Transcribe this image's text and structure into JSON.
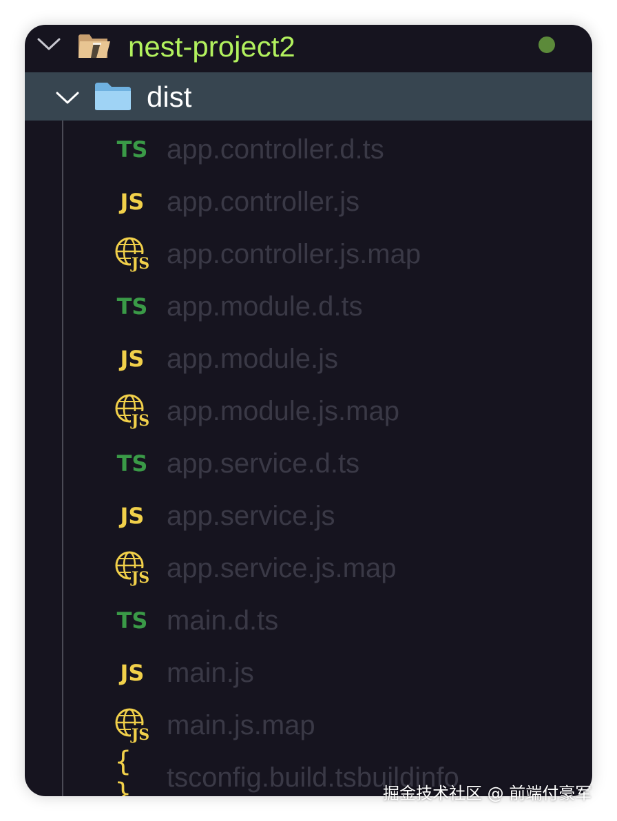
{
  "project": {
    "name": "nest-project2",
    "status_color": "#5c8a3a",
    "icon": "folder-open-icon"
  },
  "folder": {
    "name": "dist",
    "icon": "folder-icon"
  },
  "files": [
    {
      "name": "app.controller.d.ts",
      "type": "ts",
      "icon_label": "TS",
      "icon": "typescript-icon"
    },
    {
      "name": "app.controller.js",
      "type": "js",
      "icon_label": "JS",
      "icon": "javascript-icon"
    },
    {
      "name": "app.controller.js.map",
      "type": "map",
      "icon_label": "JS",
      "icon": "js-map-globe-icon"
    },
    {
      "name": "app.module.d.ts",
      "type": "ts",
      "icon_label": "TS",
      "icon": "typescript-icon"
    },
    {
      "name": "app.module.js",
      "type": "js",
      "icon_label": "JS",
      "icon": "javascript-icon"
    },
    {
      "name": "app.module.js.map",
      "type": "map",
      "icon_label": "JS",
      "icon": "js-map-globe-icon"
    },
    {
      "name": "app.service.d.ts",
      "type": "ts",
      "icon_label": "TS",
      "icon": "typescript-icon"
    },
    {
      "name": "app.service.js",
      "type": "js",
      "icon_label": "JS",
      "icon": "javascript-icon"
    },
    {
      "name": "app.service.js.map",
      "type": "map",
      "icon_label": "JS",
      "icon": "js-map-globe-icon"
    },
    {
      "name": "main.d.ts",
      "type": "ts",
      "icon_label": "TS",
      "icon": "typescript-icon"
    },
    {
      "name": "main.js",
      "type": "js",
      "icon_label": "JS",
      "icon": "javascript-icon"
    },
    {
      "name": "main.js.map",
      "type": "map",
      "icon_label": "JS",
      "icon": "js-map-globe-icon"
    },
    {
      "name": "tsconfig.build.tsbuildinfo",
      "type": "json",
      "icon_label": "{ }",
      "icon": "braces-icon"
    }
  ],
  "colors": {
    "background": "#16141f",
    "selected_row": "#374550",
    "project_text": "#b2f15e",
    "ts": "#3a9a47",
    "js": "#f1d04a",
    "file_text": "#3a3946"
  },
  "watermark": "掘金技术社区 @ 前端付豪军"
}
